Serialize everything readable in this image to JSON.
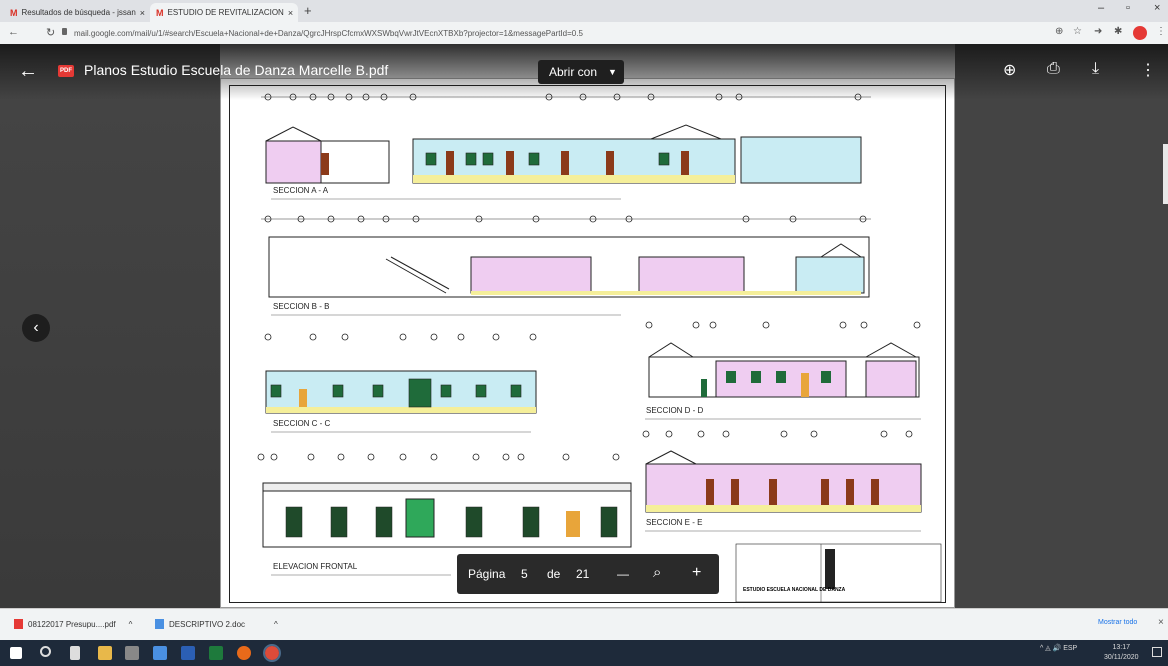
{
  "browser": {
    "tabs": [
      {
        "label": "Resultados de búsqueda - jssan",
        "close": "×"
      },
      {
        "label": "ESTUDIO DE REVITALIZACION ",
        "close": "×"
      }
    ],
    "new_tab": "+",
    "window_controls": {
      "minimize": "–",
      "maximize": "▫",
      "close": "×"
    },
    "url": "mail.google.com/mail/u/1/#search/Escuela+Nacional+de+Danza/QgrcJHrspCfcmxWXSWbqVwrJtVEcnXTBXb?projector=1&messagePartId=0.5"
  },
  "viewer": {
    "file_name": "Planos Estudio Escuela de Danza Marcelle B.pdf",
    "pdf_badge": "PDF",
    "open_with": "Abrir con",
    "pagination": {
      "label": "Página",
      "current": "5",
      "of": "de",
      "total": "21",
      "minus": "—",
      "plus": "+"
    }
  },
  "drawing": {
    "sections": [
      "SECCION A - A",
      "SECCION B - B",
      "SECCION C - C",
      "SECCION D - D",
      "SECCION E - E",
      "ELEVACION FRONTAL"
    ],
    "cartouche": "ESTUDIO ESCUELA NACIONAL DE DANZA"
  },
  "downloads": {
    "items": [
      {
        "name": "08122017 Presupu....pdf",
        "caret": "^"
      },
      {
        "name": "DESCRIPTIVO 2.doc",
        "caret": "^"
      }
    ],
    "show_all": "Mostrar todo",
    "close": "×"
  },
  "taskbar": {
    "tray": "^ ◬ 🔊 ESP",
    "time": "13:17",
    "date": "30/11/2020"
  },
  "colors": {
    "accent_red": "#d93025",
    "wall_blue": "#c9ecf3",
    "wall_pink": "#efcdf1",
    "floor_yellow": "#f5ef9a",
    "door_brown": "#8b3a1a"
  }
}
